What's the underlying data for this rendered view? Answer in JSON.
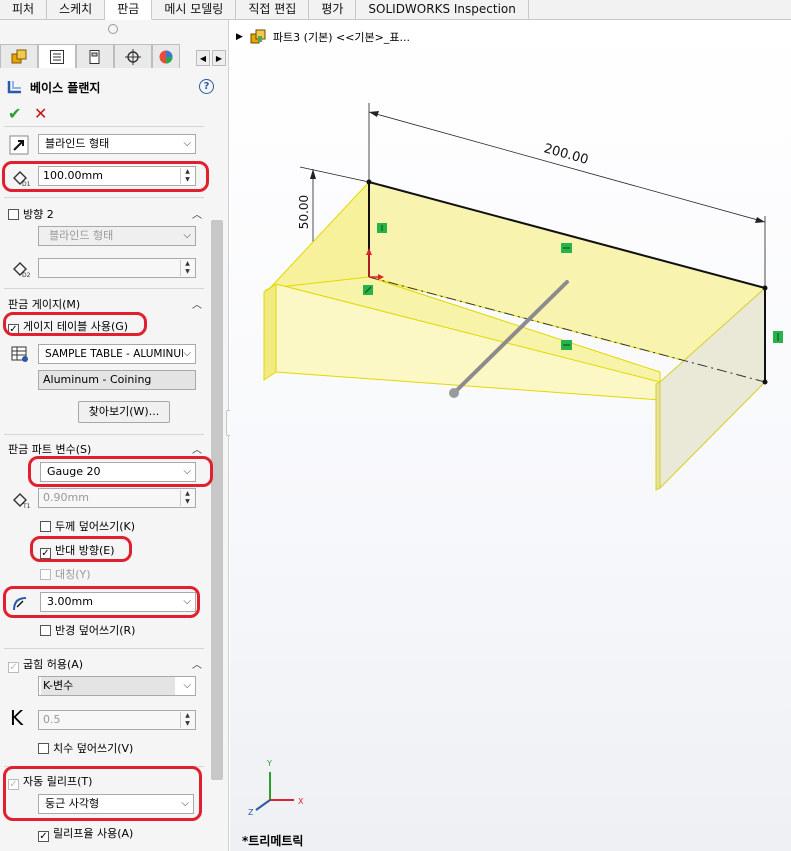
{
  "ribbon": {
    "tabs": [
      "피처",
      "스케치",
      "판금",
      "메시 모델링",
      "직접 편집",
      "평가",
      "SOLIDWORKS Inspection"
    ],
    "active_index": 2
  },
  "feature_tree": {
    "part_name": "파트3 (기본) <<기본>_표..."
  },
  "property_manager": {
    "title": "베이스 플랜지",
    "help": "?",
    "ok": "✔",
    "cancel": "✕",
    "direction1": {
      "end_condition": "블라인드 형태",
      "depth": "100.00mm"
    },
    "direction2": {
      "label": "방향 2",
      "end_condition": "블라인드 형태",
      "depth": ""
    },
    "gauge": {
      "header": "판금 게이지(M)",
      "use_table": "게이지 테이블 사용(G)",
      "table": "SAMPLE TABLE - ALUMINUM",
      "material": "Aluminum - Coining",
      "browse": "찾아보기(W)..."
    },
    "params": {
      "header": "판금 파트 변수(S)",
      "gauge_value": "Gauge 20",
      "thickness": "0.90mm",
      "override_thickness": "두께 덮어쓰기(K)",
      "reverse_direction": "반대 방향(E)",
      "symmetric": "대칭(Y)",
      "radius": "3.00mm",
      "override_radius": "반경 덮어쓰기(R)"
    },
    "bend_allowance": {
      "header": "굽힘 허용(A)",
      "type": "K-변수",
      "k_symbol": "K",
      "k_value": "0.5",
      "override_value": "치수 덮어쓰기(V)"
    },
    "auto_relief": {
      "header": "자동 릴리프(T)",
      "type": "둥근 사각형",
      "use_relief": "릴리프율 사용(A)"
    }
  },
  "graphics": {
    "dimensions": [
      "200.00",
      "50.00"
    ],
    "view_name": "*트리메트릭",
    "triad": {
      "x": "X",
      "y": "Y",
      "z": "Z"
    }
  },
  "colors": {
    "highlight": "#e0202f",
    "part_fill": "#f7f39a",
    "part_edge": "#e3d800",
    "relation_green": "#27b34a"
  }
}
